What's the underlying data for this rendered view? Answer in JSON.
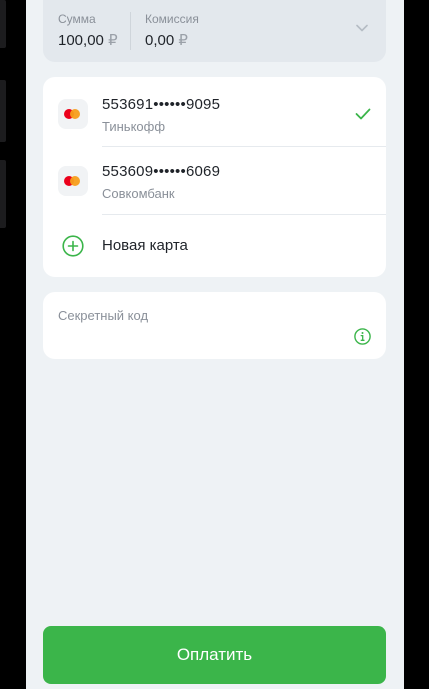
{
  "payment": {
    "amount_label": "Сумма",
    "amount_value": "100,00",
    "amount_currency": "₽",
    "fee_label": "Комиссия",
    "fee_value": "0,00",
    "fee_currency": "₽"
  },
  "cards": [
    {
      "number": "553691••••••9095",
      "bank": "Тинькофф",
      "selected": true,
      "icon": "mastercard-icon"
    },
    {
      "number": "553609••••••6069",
      "bank": "Совкомбанк",
      "selected": false,
      "icon": "mastercard-icon"
    }
  ],
  "new_card": {
    "label": "Новая карта",
    "icon": "plus-circle-icon"
  },
  "secret_code": {
    "placeholder": "Секретный код",
    "icon": "info-icon"
  },
  "pay_button": {
    "label": "Оплатить"
  },
  "colors": {
    "accent": "#3bb54a",
    "background": "#eef2f5",
    "card": "#ffffff",
    "text_primary": "#1f2329",
    "text_secondary": "#8a9099"
  }
}
